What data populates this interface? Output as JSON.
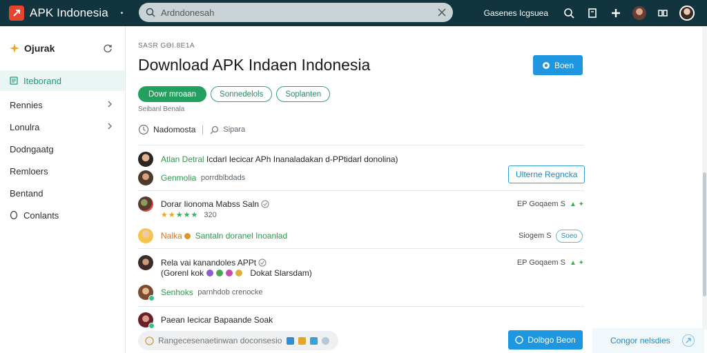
{
  "app": {
    "title": "APK Indonesia",
    "search_placeholder": "Ardndonesah",
    "top_link": "Gasenes Icgsuea"
  },
  "sidebar": {
    "header": "Ojurak",
    "items": [
      {
        "label": "Iteborand",
        "active": true
      },
      {
        "label": "Rennies",
        "chevron": true
      },
      {
        "label": "Lonulra",
        "chevron": true
      },
      {
        "label": "Dodngaatg"
      },
      {
        "label": "Remloers"
      },
      {
        "label": "Bentand"
      },
      {
        "label": "Conlants"
      }
    ]
  },
  "main": {
    "breadcrumb": "SАSR GӨI.8E1A",
    "title": "Download APK Indaen Indonesia",
    "primary_button": "Boen",
    "pills": [
      "Dowr mroaan",
      "Sonnedelols",
      "Soplanten"
    ],
    "subnote": "Seibanl Benala",
    "filter_label": "Nadomosta",
    "filter_secondary": "Sipara",
    "rows": [
      {
        "name": "Atlan Detral",
        "text": "Icdarl Iecicar APh Inanaladakan d-PPtidarl donolina)",
        "button": "Ulterne Regncka"
      },
      {
        "name": "Genmolia",
        "text": "porrdblbdads"
      },
      {
        "name": "Dorar Iionoma Mabss Saln",
        "rating": "320",
        "right": "EP Goqaem S"
      },
      {
        "name": "Nalka",
        "text": "Santaln doranel Inoanlad",
        "right": "Siogem S",
        "button": "Soeo"
      },
      {
        "name": "Rela vai kanandoles APPt",
        "text": "(Gorenl kok",
        "text2": "Dokat Slarsdam)",
        "right": "EP Goqaem S"
      },
      {
        "name": "Senhoks",
        "text": "parnhdob crenocke"
      },
      {
        "name": "Paean Iecicar Bapaande Soak"
      }
    ]
  },
  "bottom": {
    "input_placeholder": "Rangecesenaetinwan doconsesion",
    "send_button": "Dolbgo Beon",
    "help": "Congor nelsdies"
  },
  "colors": {
    "topbar": "#11343f",
    "accent_green": "#21a05e",
    "accent_blue": "#1e97e0",
    "logo": "#e8432f"
  }
}
